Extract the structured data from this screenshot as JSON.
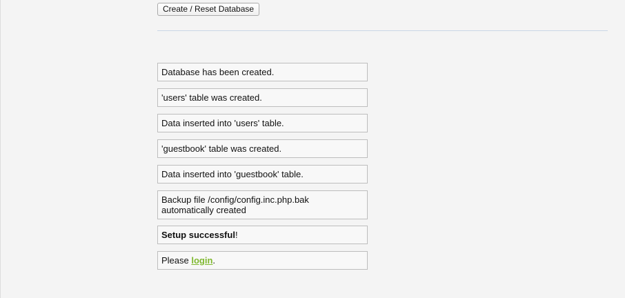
{
  "setup": {
    "reset_button_label": "Create / Reset Database"
  },
  "messages": [
    "Database has been created.",
    "'users' table was created.",
    "Data inserted into 'users' table.",
    "'guestbook' table was created.",
    "Data inserted into 'guestbook' table.",
    "Backup file /config/config.inc.php.bak automatically created"
  ],
  "success": {
    "bold_text": "Setup successful",
    "suffix": "!"
  },
  "login": {
    "prefix": "Please ",
    "link_text": "login",
    "suffix": "."
  }
}
